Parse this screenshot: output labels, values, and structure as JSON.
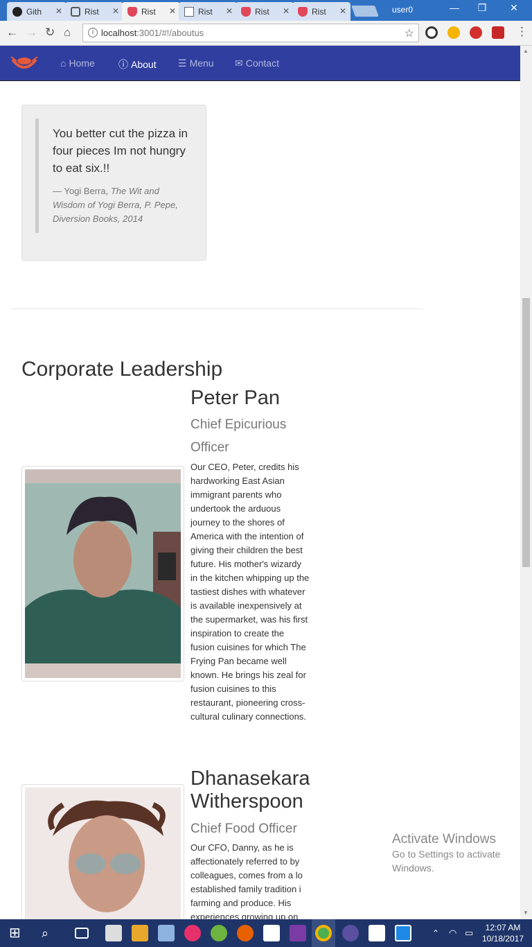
{
  "browser": {
    "tabs": [
      {
        "label": "Gith",
        "kind": "github"
      },
      {
        "label": "Rist",
        "kind": "angular"
      },
      {
        "label": "Rist",
        "kind": "ristorante",
        "active": true
      },
      {
        "label": "Rist",
        "kind": "doc"
      },
      {
        "label": "Rist",
        "kind": "ristorante"
      },
      {
        "label": "Rist",
        "kind": "ristorante"
      }
    ],
    "user": "user0",
    "url_host": "localhost",
    "url_path": ":3001/#!/aboutus"
  },
  "nav": {
    "home": "Home",
    "about": "About",
    "menu": "Menu",
    "contact": "Contact"
  },
  "quote": {
    "text": "You better cut the pizza in four pieces Im not hungry to eat six.!!",
    "author": "— Yogi Berra, ",
    "source": "The Wit and Wisdom of Yogi Berra, P. Pepe, Diversion Books, 2014"
  },
  "leadership": {
    "heading": "Corporate Leadership",
    "leaders": [
      {
        "name": "Peter Pan",
        "role": "Chief Epicurious Officer",
        "bio": "Our CEO, Peter, credits his hardworking East Asian immigrant parents who undertook the arduous journey to the shores of America with the intention of giving their children the best future. His mother's wizardy in the kitchen whipping up the tastiest dishes with whatever is available inexpensively at the supermarket, was his first inspiration to create the fusion cuisines for which The Frying Pan became well known. He brings his zeal for fusion cuisines to this restaurant, pioneering cross-cultural culinary connections."
      },
      {
        "name": "Dhanasekara Witherspoon",
        "role": "Chief Food Officer",
        "bio": "Our CFO, Danny, as he is affectionately referred to by colleagues, comes from a lo established family tradition i farming and produce. His experiences growing up on"
      }
    ]
  },
  "watermark": {
    "title": "Activate Windows",
    "line1": "Go to Settings to activate",
    "line2": "Windows."
  },
  "taskbar": {
    "time": "12:07 AM",
    "date": "10/18/2017"
  },
  "colors": {
    "navbar": "#303f9f",
    "tabbar": "#2f72c4",
    "taskbar": "#1f3569"
  }
}
